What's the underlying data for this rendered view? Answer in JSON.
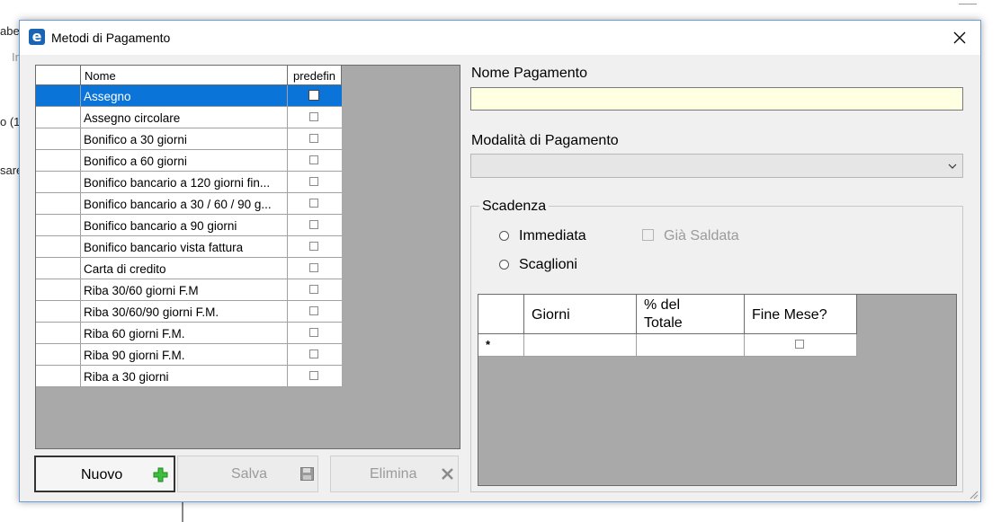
{
  "background": {
    "fragments": [
      "abe",
      "In",
      "o (1",
      "sare"
    ]
  },
  "window": {
    "title": "Metodi di Pagamento",
    "icon": "app-e-icon",
    "close": "close-icon"
  },
  "grid": {
    "headers": {
      "nome": "Nome",
      "predefinito": "predefin"
    },
    "rows": [
      {
        "nome": "Assegno",
        "predefinito": false,
        "selected": true
      },
      {
        "nome": "Assegno circolare",
        "predefinito": false
      },
      {
        "nome": "Bonifico a 30 giorni",
        "predefinito": false
      },
      {
        "nome": "Bonifico a 60 giorni",
        "predefinito": false
      },
      {
        "nome": "Bonifico bancario a 120 giorni fin...",
        "predefinito": false
      },
      {
        "nome": "Bonifico bancario a 30 / 60 / 90 g...",
        "predefinito": false
      },
      {
        "nome": "Bonifico bancario a 90 giorni",
        "predefinito": false
      },
      {
        "nome": "Bonifico bancario vista fattura",
        "predefinito": false
      },
      {
        "nome": "Carta di credito",
        "predefinito": false
      },
      {
        "nome": "Riba 30/60 giorni F.M",
        "predefinito": false
      },
      {
        "nome": "Riba 30/60/90 giorni F.M.",
        "predefinito": false
      },
      {
        "nome": "Riba 60 giorni F.M.",
        "predefinito": false
      },
      {
        "nome": "Riba 90 giorni F.M.",
        "predefinito": false
      },
      {
        "nome": "Riba a 30 giorni",
        "predefinito": false
      }
    ]
  },
  "buttons": {
    "nuovo": "Nuovo",
    "salva": "Salva",
    "elimina": "Elimina"
  },
  "form": {
    "nome_label": "Nome Pagamento",
    "nome_value": "",
    "modalita_label": "Modalità di Pagamento",
    "modalita_value": "",
    "scadenza_label": "Scadenza",
    "immediata": "Immediata",
    "scaglioni": "Scaglioni",
    "gia_saldata": "Già Saldata"
  },
  "scadenze_grid": {
    "headers": {
      "giorni": "Giorni",
      "percent_line1": "% del",
      "percent_line2": "Totale",
      "fine_mese": "Fine Mese?"
    },
    "new_row_marker": "*"
  },
  "colors": {
    "selection": "#0a74d8",
    "input_highlight": "#ffffe1",
    "add_icon": "#3cbf3c"
  }
}
